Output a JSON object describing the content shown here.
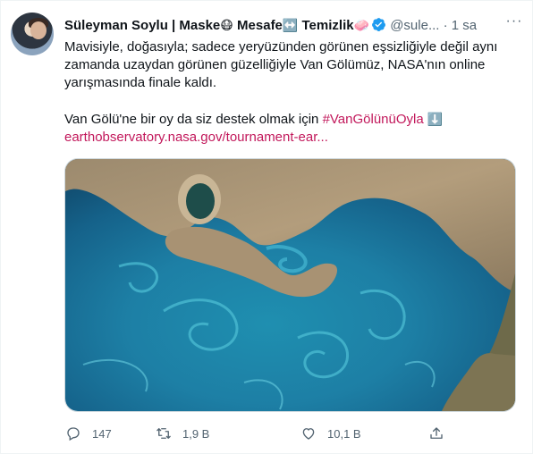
{
  "tweet": {
    "author_name": "Süleyman Soylu | Maske",
    "mask_emoji": "😷",
    "name_part2": " Mesafe",
    "arrow_emoji": "↔️",
    "name_part3": " Temizlik",
    "soap_emoji": "🧼",
    "handle": "@sule...",
    "dot": "·",
    "time": "1 sa",
    "more_icon": "ellipsis-icon",
    "text_line1": "Mavisiyle, doğasıyla; sadece yeryüzünden görünen eşsizliğiyle değil aynı zamanda uzaydan görünen güzelliğiyle Van Gölümüz, NASA'nın online yarışmasında finale kaldı.",
    "text_line2_prefix": "Van Gölü'ne bir oy da siz destek olmak için ",
    "hashtag": "#VanGölünüOyla",
    "down_emoji": "⬇️",
    "link": "earthobservatory.nasa.gov/tournament-ear...",
    "image_subject": "Lake Van satellite image"
  },
  "actions": {
    "reply_count": "147",
    "retweet_count": "1,9 B",
    "like_count": "10,1 B"
  },
  "colors": {
    "hashtag": "#c2185b",
    "secondary_text": "#536471",
    "verified": "#1d9bf0"
  }
}
